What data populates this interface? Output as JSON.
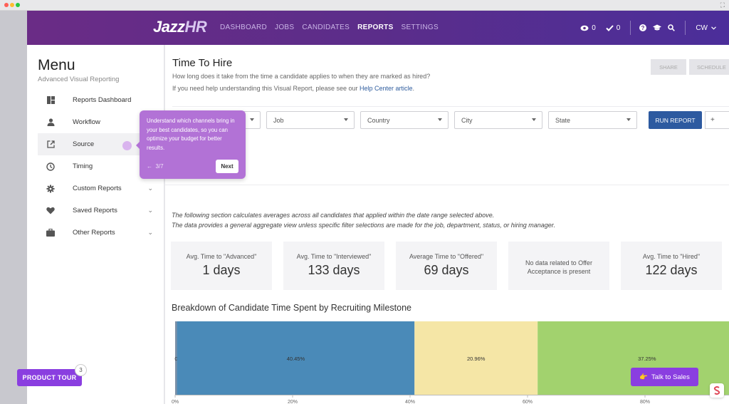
{
  "nav": {
    "logo_main": "Jazz",
    "logo_suffix": "HR",
    "links": [
      "DASHBOARD",
      "JOBS",
      "CANDIDATES",
      "REPORTS",
      "SETTINGS"
    ],
    "active": "REPORTS",
    "views_count": "0",
    "checks_count": "0",
    "user_initials": "CW"
  },
  "sidebar": {
    "title": "Menu",
    "subtitle": "Advanced Visual Reporting",
    "items": [
      {
        "label": "Reports Dashboard",
        "icon": "dashboard-icon"
      },
      {
        "label": "Workflow",
        "icon": "person-icon"
      },
      {
        "label": "Source",
        "icon": "external-link-icon"
      },
      {
        "label": "Timing",
        "icon": "clock-icon"
      },
      {
        "label": "Custom Reports",
        "icon": "gear-icon"
      },
      {
        "label": "Saved Reports",
        "icon": "heart-icon"
      },
      {
        "label": "Other Reports",
        "icon": "briefcase-icon"
      }
    ]
  },
  "tooltip": {
    "text": "Understand which channels bring in your best candidates, so you can optimize your budget for better results.",
    "step": "3/7",
    "next_label": "Next"
  },
  "report": {
    "title": "Time To Hire",
    "description": "How long does it take from the time a candidate applies to when they are marked as hired?",
    "help_prefix": "If you need help understanding this Visual Report, please see our ",
    "help_link": "Help Center article",
    "help_suffix": ".",
    "share_label": "SHARE",
    "schedule_label": "SCHEDULE",
    "filters": {
      "job": "Job",
      "country": "Country",
      "city": "City",
      "state": "State",
      "run_label": "RUN REPORT",
      "add_label": "+"
    },
    "note1": "The following section calculates averages across all candidates that applied within the date range selected above.",
    "note2": "The data provides a general aggregate view unless specific filter selections are made for the job, department, status, or hiring manager.",
    "cards": [
      {
        "label": "Avg. Time to \"Advanced\"",
        "value": "1 days"
      },
      {
        "label": "Avg. Time to \"Interviewed\"",
        "value": "133 days"
      },
      {
        "label": "Average Time to \"Offered\"",
        "value": "69 days"
      },
      {
        "label": "No data related to Offer Acceptance is present",
        "value": ""
      },
      {
        "label": "Avg. Time to \"Hired\"",
        "value": "122 days"
      }
    ],
    "breakdown_title": "Breakdown of Candidate Time Spent by Recruiting Milestone"
  },
  "chart_data": {
    "type": "bar",
    "orientation": "horizontal-stacked",
    "segments": [
      {
        "label": "0.31%",
        "value": 0.31,
        "color": "#7a8fa6"
      },
      {
        "label": "40.45%",
        "value": 40.45,
        "color": "#4a8ab8"
      },
      {
        "label": "20.96%",
        "value": 20.96,
        "color": "#f5e6a6"
      },
      {
        "label": "37.25%",
        "value": 37.25,
        "color": "#a2d26e"
      }
    ],
    "x_ticks": [
      "0%",
      "20%",
      "40%",
      "60%",
      "80%"
    ],
    "xlim": [
      0,
      100
    ]
  },
  "floating": {
    "tour_label": "PRODUCT TOUR",
    "tour_badge": "3",
    "sales_label": "Talk to Sales"
  },
  "colors": {
    "brand_purple": "#6a2c86",
    "accent_purple": "#8a3ee0",
    "run_blue": "#2d5aa0"
  }
}
